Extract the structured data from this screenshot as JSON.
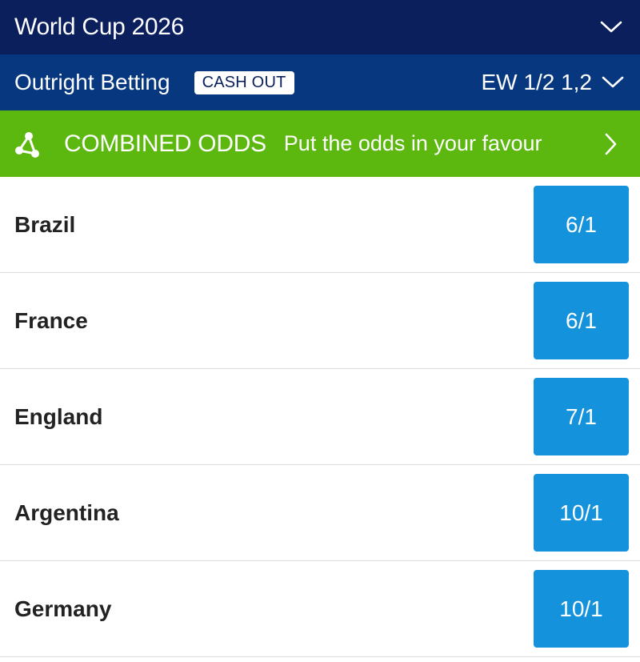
{
  "header": {
    "title": "World Cup 2026",
    "toggle_icon": "chevron-down-icon"
  },
  "subheader": {
    "title": "Outright Betting",
    "badge": "CASH OUT",
    "each_way": "EW 1/2 1,2",
    "toggle_icon": "chevron-down-icon"
  },
  "promo": {
    "title": "COMBINED ODDS",
    "subtitle": "Put the odds in your favour",
    "icon": "share-nodes-icon",
    "arrow_icon": "chevron-right-icon"
  },
  "markets": [
    {
      "team": "Brazil",
      "odds": "6/1"
    },
    {
      "team": "France",
      "odds": "6/1"
    },
    {
      "team": "England",
      "odds": "7/1"
    },
    {
      "team": "Argentina",
      "odds": "10/1"
    },
    {
      "team": "Germany",
      "odds": "10/1"
    }
  ],
  "colors": {
    "header_bg": "#0a1f5c",
    "subheader_bg": "#07377f",
    "promo_bg": "#5cb80f",
    "odds_bg": "#1592dc"
  }
}
